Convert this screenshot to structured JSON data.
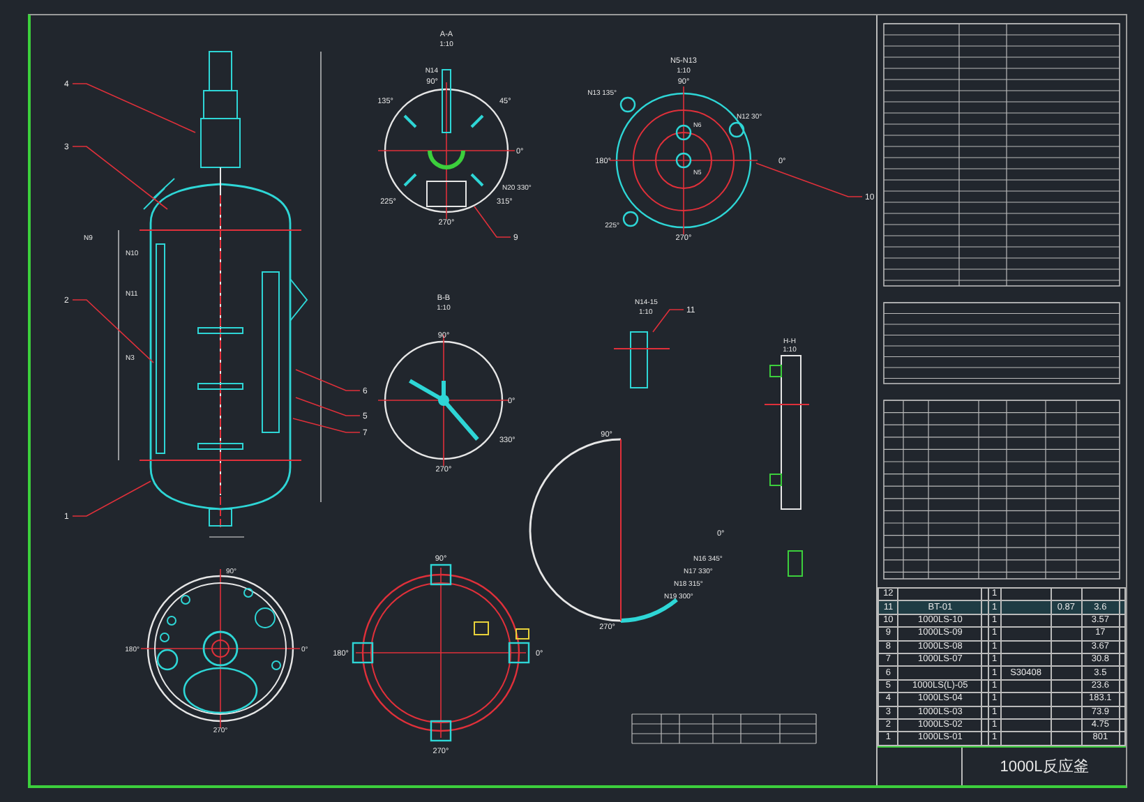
{
  "elevation": {
    "leaders": [
      "4",
      "3",
      "2",
      "1",
      "6",
      "5",
      "7"
    ],
    "nozzles": [
      "N9",
      "N10",
      "N11",
      "N3"
    ]
  },
  "section_a": {
    "title": "A-A",
    "scale": "1:10",
    "angles": [
      "90°",
      "135°",
      "45°",
      "0°",
      "225°",
      "315°",
      "270°"
    ],
    "nozzles": [
      "N14",
      "N20 330°"
    ],
    "leader": "9"
  },
  "nozzle_plan": {
    "title": "N5-N13",
    "scale": "1:10",
    "angles": [
      "90°",
      "180°",
      "0°",
      "270°"
    ],
    "nozzles": [
      "N13 135°",
      "N12 30°",
      "N6",
      "N5",
      "225°"
    ],
    "leader": "10"
  },
  "section_b": {
    "title": "B-B",
    "scale": "1:10",
    "angles": [
      "90°",
      "0°",
      "270°",
      "330°"
    ]
  },
  "detail_n14": {
    "title": "N14-15",
    "scale": "1:10",
    "leader": "11"
  },
  "detail_h": {
    "title": "H-H",
    "scale": "1:10"
  },
  "half_section": {
    "angles": [
      "90°",
      "0°",
      "270°"
    ],
    "nozzles": [
      "N16 345°",
      "N17 330°",
      "N18 315°",
      "N19 300°"
    ]
  },
  "top_plan": {
    "angles": [
      "90°",
      "0°",
      "180°",
      "270°"
    ]
  },
  "support_plan": {
    "angles": [
      "90°",
      "0°",
      "180°",
      "270°"
    ]
  },
  "parts": [
    {
      "no": "12",
      "qty": "1"
    },
    {
      "no": "11",
      "code": "BT-01",
      "qty": "1",
      "unit_mass": "0.87",
      "total_mass": "3.6"
    },
    {
      "no": "10",
      "code": "1000LS-10",
      "qty": "1",
      "total_mass": "3.57"
    },
    {
      "no": "9",
      "code": "1000LS-09",
      "qty": "1",
      "total_mass": "17"
    },
    {
      "no": "8",
      "code": "1000LS-08",
      "qty": "1",
      "total_mass": "3.67"
    },
    {
      "no": "7",
      "code": "1000LS-07",
      "qty": "1",
      "total_mass": "30.8"
    },
    {
      "no": "6",
      "qty": "1",
      "material": "S30408",
      "total_mass": "3.5"
    },
    {
      "no": "5",
      "code": "1000LS(L)-05",
      "qty": "1",
      "total_mass": "23.6"
    },
    {
      "no": "4",
      "code": "1000LS-04",
      "qty": "1",
      "total_mass": "183.1"
    },
    {
      "no": "3",
      "code": "1000LS-03",
      "qty": "1",
      "total_mass": "73.9"
    },
    {
      "no": "2",
      "code": "1000LS-02",
      "qty": "1",
      "total_mass": "4.75"
    },
    {
      "no": "1",
      "code": "1000LS-01",
      "qty": "1",
      "total_mass": "801"
    }
  ],
  "title_block": {
    "drawing_name": "1000L反应釜"
  }
}
